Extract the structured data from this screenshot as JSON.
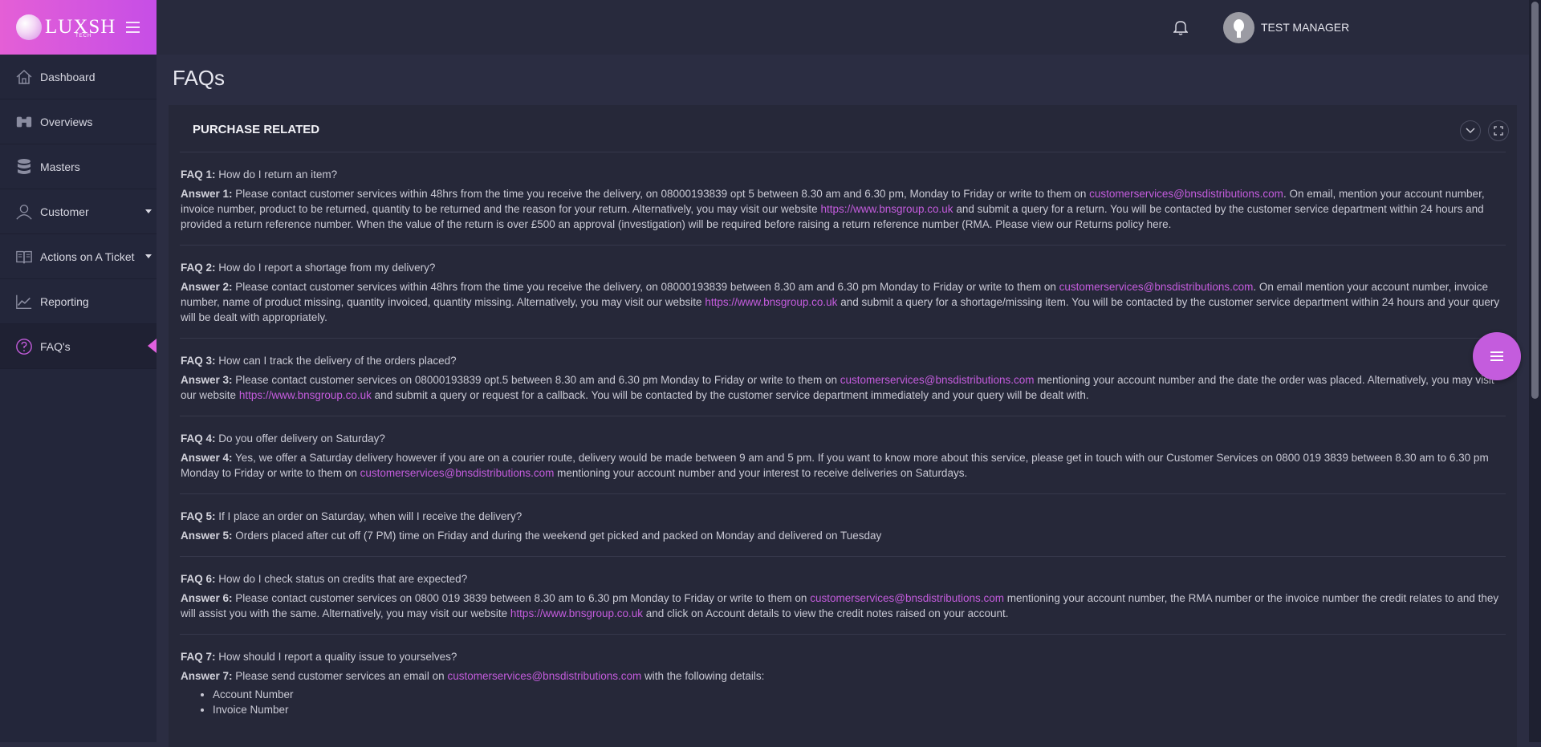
{
  "brand": {
    "logo_text": "LUXSH",
    "logo_sub": "TECH"
  },
  "sidebar": {
    "items": [
      {
        "label": "Dashboard"
      },
      {
        "label": "Overviews"
      },
      {
        "label": "Masters"
      },
      {
        "label": "Customer"
      },
      {
        "label": "Actions on A Ticket"
      },
      {
        "label": "Reporting"
      },
      {
        "label": "FAQ's"
      }
    ]
  },
  "header": {
    "user_name": "TEST MANAGER"
  },
  "page": {
    "title": "FAQs"
  },
  "card": {
    "title": "PURCHASE RELATED"
  },
  "faqs": [
    {
      "q_label": "FAQ 1:",
      "question": "How do I return an item?",
      "a_label": "Answer 1:",
      "a1": "Please contact customer services within 48hrs from the time you receive the delivery, on 08000193839 opt 5 between 8.30 am and 6.30 pm, Monday to Friday or write to them on",
      "email": "customerservices@bnsdistributions.com",
      "a2": ". On email, mention your account number, invoice number, product to be returned, quantity to be returned and the reason for your return. Alternatively, you may visit our website",
      "website": "https://www.bnsgroup.co.uk",
      "a3": "and submit a query for a return. You will be contacted by the customer service department within 24 hours and provided a return reference number. When the value of the return is over £500 an approval (investigation) will be required before raising a return reference number (RMA. Please view our Returns policy here."
    },
    {
      "q_label": "FAQ 2:",
      "question": "How do I report a shortage from my delivery?",
      "a_label": "Answer 2:",
      "a1": "Please contact customer services within 48hrs from the time you receive the delivery, on 08000193839 between 8.30 am and 6.30 pm Monday to Friday or write to them on",
      "email": "customerservices@bnsdistributions.com",
      "a2": ". On email mention your account number, invoice number, name of product missing, quantity invoiced, quantity missing. Alternatively, you may visit our website",
      "website": "https://www.bnsgroup.co.uk",
      "a3": "and submit a query for a shortage/missing item. You will be contacted by the customer service department within 24 hours and your query will be dealt with appropriately."
    },
    {
      "q_label": "FAQ 3:",
      "question": "How can I track the delivery of the orders placed?",
      "a_label": "Answer 3:",
      "a1": "Please contact customer services on 08000193839 opt.5 between 8.30 am and 6.30 pm Monday to Friday or write to them on",
      "email": "customerservices@bnsdistributions.com",
      "a2": "mentioning your account number and the date the order was placed. Alternatively, you may visit our website",
      "website": "https://www.bnsgroup.co.uk",
      "a3": "and submit a query or request for a callback. You will be contacted by the customer service department immediately and your query will be dealt with."
    },
    {
      "q_label": "FAQ 4:",
      "question": "Do you offer delivery on Saturday?",
      "a_label": "Answer 4:",
      "a1": "Yes, we offer a Saturday delivery however if you are on a courier route, delivery would be made between 9 am and 5 pm. If you want to know more about this service, please get in touch with our Customer Services on 0800 019 3839 between 8.30 am to 6.30 pm Monday to Friday or write to them on",
      "email": "customerservices@bnsdistributions.com",
      "a2": "mentioning your account number and your interest to receive deliveries on Saturdays."
    },
    {
      "q_label": "FAQ 5:",
      "question": "If I place an order on Saturday, when will I receive the delivery?",
      "a_label": "Answer 5:",
      "a1": "Orders placed after cut off (7 PM) time on Friday and during the weekend get picked and packed on Monday and delivered on Tuesday"
    },
    {
      "q_label": "FAQ 6:",
      "question": "How do I check status on credits that are expected?",
      "a_label": "Answer 6:",
      "a1": "Please contact customer services on 0800 019 3839 between 8.30 am to 6.30 pm Monday to Friday or write to them on",
      "email": "customerservices@bnsdistributions.com",
      "a2": "mentioning your account number, the RMA number or the invoice number the credit relates to and they will assist you with the same. Alternatively, you may visit our website",
      "website": "https://www.bnsgroup.co.uk",
      "a3": "and click on Account details to view the credit notes raised on your account."
    },
    {
      "q_label": "FAQ 7:",
      "question": "How should I report a quality issue to yourselves?",
      "a_label": "Answer 7:",
      "a1": "Please send customer services an email on",
      "email": "customerservices@bnsdistributions.com",
      "a2": "with the following details:",
      "list": [
        "Account Number",
        "Invoice Number"
      ]
    }
  ],
  "colors": {
    "accent": "#c45cdd",
    "sidebar_bg": "#23263a",
    "content_bg": "#2b2d42",
    "card_bg": "#262839"
  },
  "icons": [
    "home-icon",
    "binoculars-icon",
    "database-icon",
    "user-icon",
    "book-icon",
    "chart-line-icon",
    "question-circle-icon",
    "bell-icon",
    "chevron-down-icon",
    "expand-icon",
    "menu-icon"
  ]
}
